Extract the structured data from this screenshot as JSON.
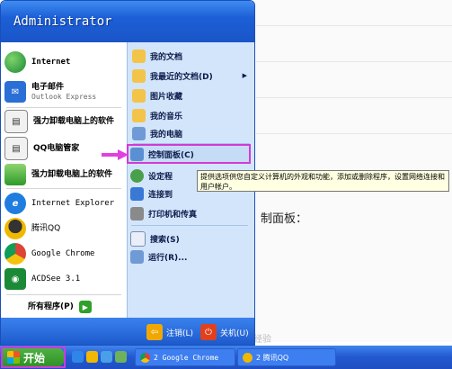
{
  "header": {
    "username": "Administrator"
  },
  "left_items": [
    {
      "label": "Internet",
      "icon": "internet-globe-icon"
    },
    {
      "label": "电子邮件",
      "sublabel": "Outlook Express",
      "icon": "email-icon"
    },
    {
      "label": "强力卸载电脑上的软件",
      "icon": "uninstall-icon"
    },
    {
      "label": "QQ电脑管家",
      "icon": "qq-manager-icon"
    },
    {
      "label": "强力卸载电脑上的软件",
      "icon": "uninstall-app-icon"
    },
    {
      "label": "Internet Explorer",
      "icon": "ie-icon"
    },
    {
      "label": "腾讯QQ",
      "icon": "qq-penguin-icon"
    },
    {
      "label": "Google Chrome",
      "icon": "chrome-icon"
    },
    {
      "label": "ACDSee 3.1",
      "icon": "acdsee-icon"
    }
  ],
  "all_programs": "所有程序(P)",
  "right_items": [
    {
      "label": "我的文档"
    },
    {
      "label": "我最近的文档(D)"
    },
    {
      "label": "图片收藏"
    },
    {
      "label": "我的音乐"
    },
    {
      "label": "我的电脑"
    },
    {
      "label": "控制面板(C)"
    },
    {
      "label": "设定程"
    },
    {
      "label": "连接到"
    },
    {
      "label": "打印机和传真"
    },
    {
      "label": "搜索(S)"
    },
    {
      "label": "运行(R)..."
    }
  ],
  "tooltip": "提供选项供您自定义计算机的外观和功能，添加或删除程序，设置网络连接和用户帐户。",
  "footer": {
    "logoff": "注销(L)",
    "shutdown": "关机(U)"
  },
  "taskbar": {
    "start": "开始",
    "task1": "2 Google Chrome",
    "task2": "2 腾讯QQ"
  },
  "background": {
    "text": "制面板：",
    "faint": "经验"
  },
  "colors": {
    "accent": "#1c5fd6",
    "highlight_border": "#d23ad6",
    "start_green": "#3fa335"
  }
}
